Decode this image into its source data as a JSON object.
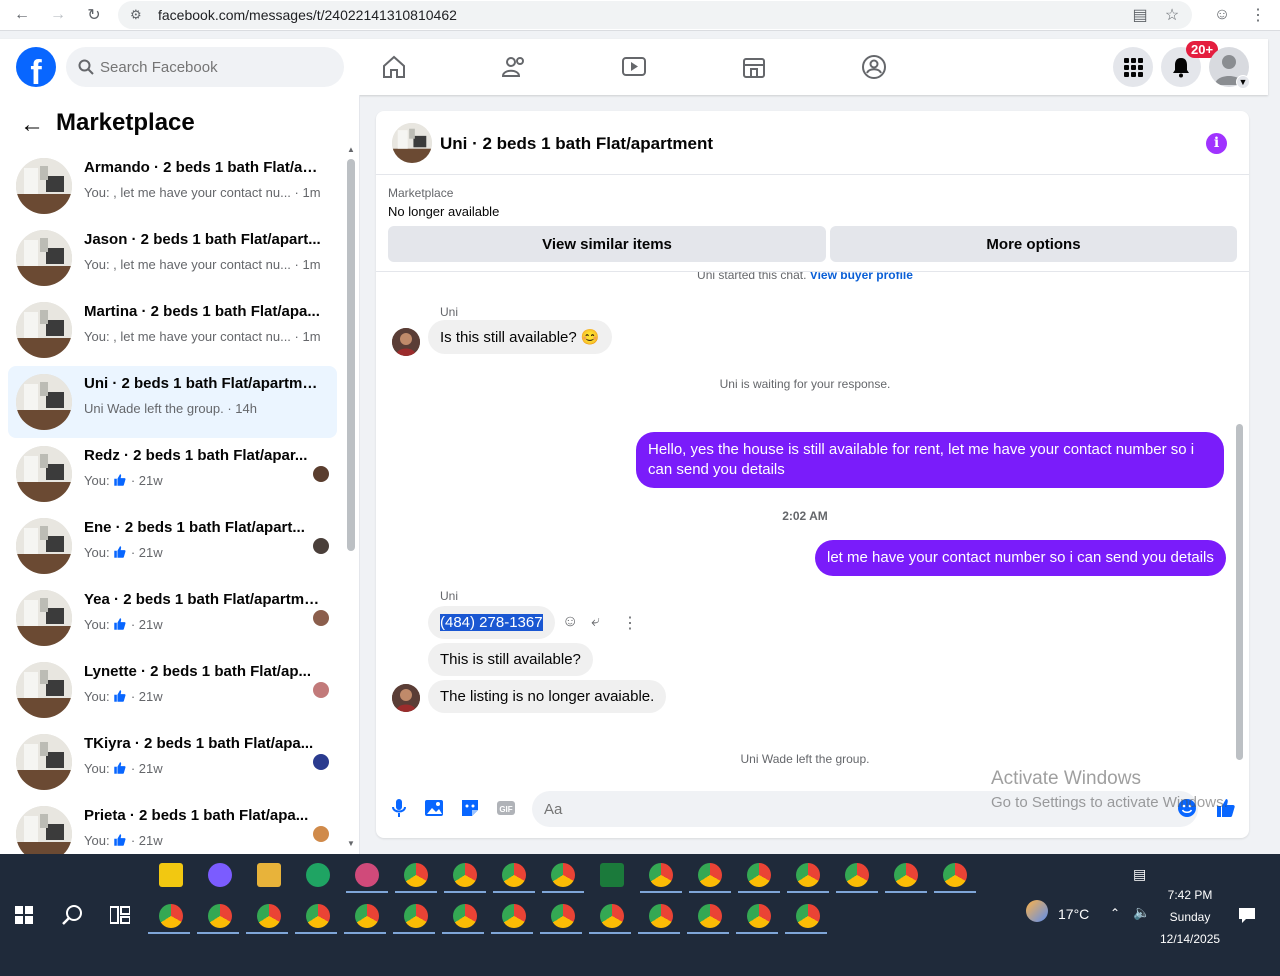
{
  "browser": {
    "url": "facebook.com/messages/t/24022141310810462"
  },
  "header": {
    "search_placeholder": "Search Facebook",
    "notification_count": "20+"
  },
  "sidebar": {
    "title": "Marketplace",
    "conversations": [
      {
        "name": "Armando · 2 beds 1 bath Flat/ap...",
        "preview": "You: , let me have your contact nu...",
        "time": "· 1m",
        "active": false,
        "like": false
      },
      {
        "name": "Jason · 2 beds 1 bath Flat/apart...",
        "preview": "You: , let me have your contact nu...",
        "time": "· 1m",
        "active": false,
        "like": false
      },
      {
        "name": "Martina · 2 beds 1 bath Flat/apa...",
        "preview": "You: , let me have your contact nu...",
        "time": "· 1m",
        "active": false,
        "like": false
      },
      {
        "name": "Uni · 2 beds 1 bath Flat/apartment",
        "preview": "Uni Wade left the group.",
        "time": "· 14h",
        "active": true,
        "like": false
      },
      {
        "name": "Redz · 2 beds 1 bath Flat/apar...",
        "preview": "You:",
        "time": "· 21w",
        "active": false,
        "like": true
      },
      {
        "name": "Ene · 2 beds 1 bath Flat/apart...",
        "preview": "You:",
        "time": "· 21w",
        "active": false,
        "like": true
      },
      {
        "name": "Yea · 2 beds 1 bath Flat/apartment",
        "preview": "You:",
        "time": "· 21w",
        "active": false,
        "like": true
      },
      {
        "name": "Lynette · 2 beds 1 bath Flat/ap...",
        "preview": "You:",
        "time": "· 21w",
        "active": false,
        "like": true
      },
      {
        "name": "TKiyra · 2 beds 1 bath Flat/apa...",
        "preview": "You:",
        "time": "· 21w",
        "active": false,
        "like": true
      },
      {
        "name": "Prieta · 2 beds 1 bath Flat/apa...",
        "preview": "You:",
        "time": "· 21w",
        "active": false,
        "like": true
      }
    ]
  },
  "chat": {
    "title": "Uni · 2 beds 1 bath Flat/apartment",
    "marketplace_label": "Marketplace",
    "listing_status": "No longer available",
    "view_similar_label": "View similar items",
    "more_options_label": "More options",
    "started_text": "Uni started this chat.",
    "buyer_profile_link": "View buyer profile",
    "sender_name": "Uni",
    "msg_1": "Is this still available? 😊",
    "waiting_text": "Uni is waiting for your response.",
    "out_msg_1": "Hello, yes the house is still available for rent, let me have your contact number so i can send you details",
    "timestamp": "2:02 AM",
    "out_msg_2": "let me have your contact number so i can send you details",
    "sender_name_2": "Uni",
    "phone_msg": "(484) 278-1367",
    "msg_3": "This is still available?",
    "msg_4": "The listing is no longer avaiable.",
    "left_text": "Uni Wade left the group.",
    "composer_placeholder": "Aa"
  },
  "watermark": {
    "line1": "Activate Windows",
    "line2": "Go to Settings to activate Windows."
  },
  "taskbar": {
    "temperature": "17°C",
    "time": "7:42 PM",
    "day": "Sunday",
    "date": "12/14/2025"
  },
  "colors": {
    "brand": "#0866ff",
    "outgoing_bubble": "#7a1cfa",
    "active_row": "#ebf5ff"
  }
}
